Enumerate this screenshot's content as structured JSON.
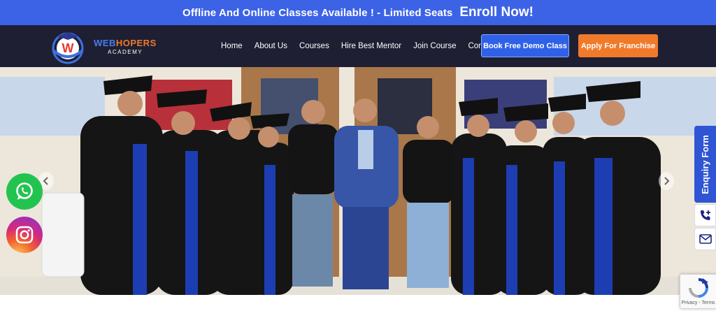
{
  "announcement": {
    "message": "Offline And Online Classes Available ! - Limited Seats",
    "cta": "Enroll Now!"
  },
  "logo": {
    "title_part1": "WEB",
    "title_part2": "HOPERS",
    "subtitle": "ACADEMY"
  },
  "nav": {
    "items": [
      "Home",
      "About Us",
      "Courses",
      "Hire Best Mentor",
      "Join Course",
      "Contact"
    ],
    "demo_button": "Book Free Demo Class",
    "franchise_button": "Apply For Franchise"
  },
  "sidebar": {
    "enquiry_label": "Enquiry Form"
  },
  "recaptcha": {
    "links": "Privacy - Terms"
  },
  "colors": {
    "announcement_bg": "#3c63e6",
    "nav_bg": "#1e1f33",
    "demo_button": "#2f61e8",
    "franchise_button": "#f07a2a",
    "whatsapp": "#23c350",
    "enquiry": "#2f55d4"
  },
  "icons": [
    "whatsapp-icon",
    "instagram-icon",
    "phone-plus-icon",
    "mail-icon",
    "recaptcha-icon",
    "chevron-left-icon",
    "chevron-right-icon"
  ]
}
